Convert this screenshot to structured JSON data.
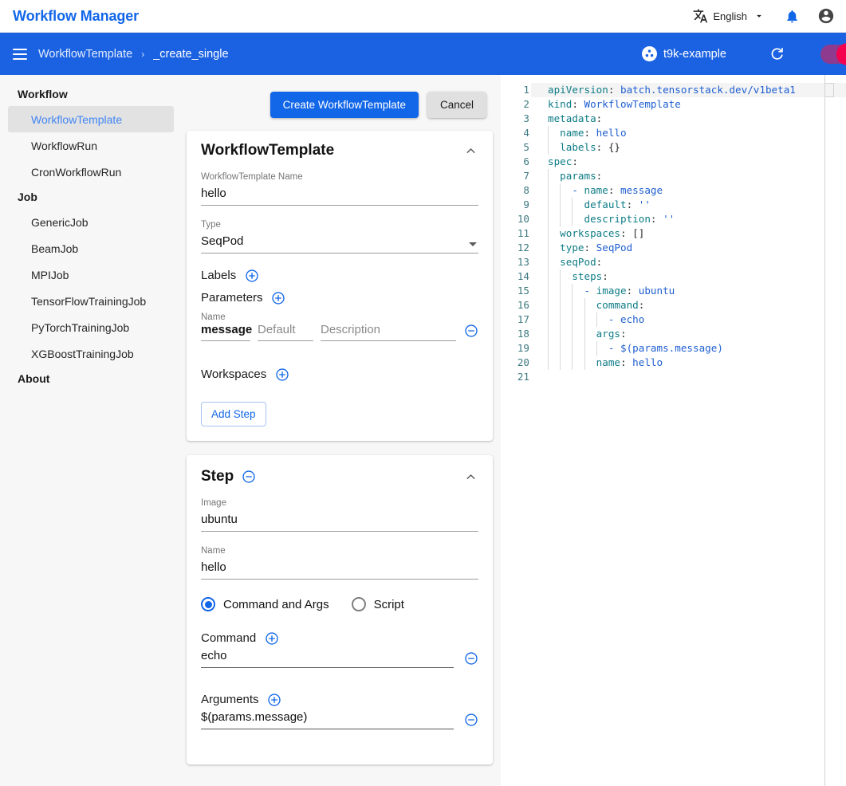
{
  "header": {
    "app_title": "Workflow Manager",
    "translate_icon": "translate-icon",
    "language": "English",
    "chevron": "chevron-down-icon",
    "bell": "notifications-icon",
    "account": "account-circle-icon"
  },
  "toolbar": {
    "menu_icon": "hamburger-menu-icon",
    "breadcrumb_root": "WorkflowTemplate",
    "breadcrumb_sep": "›",
    "breadcrumb_leaf": "_create_single",
    "project": "t9k-example",
    "project_icon": "project-avatar-icon",
    "refresh_icon": "refresh-icon",
    "toggle_name": "theme-toggle",
    "bar_color": "#1b62e3",
    "toggle_track_color": "#8e3a8e",
    "toggle_knob_color": "#f5004f"
  },
  "sidebar": {
    "groups": [
      {
        "title": "Workflow",
        "items": [
          {
            "label": "WorkflowTemplate",
            "selected": true
          },
          {
            "label": "WorkflowRun",
            "selected": false
          },
          {
            "label": "CronWorkflowRun",
            "selected": false
          }
        ]
      },
      {
        "title": "Job",
        "items": [
          {
            "label": "GenericJob",
            "selected": false
          },
          {
            "label": "BeamJob",
            "selected": false
          },
          {
            "label": "MPIJob",
            "selected": false
          },
          {
            "label": "TensorFlowTrainingJob",
            "selected": false
          },
          {
            "label": "PyTorchTrainingJob",
            "selected": false
          },
          {
            "label": "XGBoostTrainingJob",
            "selected": false
          }
        ]
      },
      {
        "title": "About",
        "items": []
      }
    ],
    "selected_color": "#4285f4"
  },
  "actions": {
    "create_label": "Create WorkflowTemplate",
    "cancel_label": "Cancel",
    "primary_color": "#1266e8"
  },
  "template_card": {
    "title": "WorkflowTemplate",
    "collapse_icon": "chevron-up-icon",
    "name_label": "WorkflowTemplate Name",
    "name_value": "hello",
    "type_label": "Type",
    "type_value": "SeqPod",
    "labels_label": "Labels",
    "labels_add_icon": "add-circle-icon",
    "parameters_label": "Parameters",
    "parameters_add_icon": "add-circle-icon",
    "param_col_name": "Name",
    "param_name_value": "message",
    "param_default_placeholder": "Default",
    "param_description_placeholder": "Description",
    "param_remove_icon": "remove-circle-icon",
    "workspaces_label": "Workspaces",
    "workspaces_add_icon": "add-circle-icon",
    "add_step_label": "Add Step"
  },
  "step_card": {
    "title": "Step",
    "remove_icon": "remove-circle-icon",
    "collapse_icon": "chevron-up-icon",
    "image_label": "Image",
    "image_value": "ubuntu",
    "name_label": "Name",
    "name_value": "hello",
    "mode_command_label": "Command and Args",
    "mode_script_label": "Script",
    "mode_selected": "Command and Args",
    "command_label": "Command",
    "command_add_icon": "add-circle-icon",
    "command_value": "echo",
    "command_remove_icon": "remove-circle-icon",
    "arguments_label": "Arguments",
    "arguments_add_icon": "add-circle-icon",
    "arguments_value": "$(params.message)",
    "arguments_remove_icon": "remove-circle-icon"
  },
  "editor": {
    "total_lines": 21,
    "active_line": 1,
    "lines": [
      {
        "n": 1,
        "guides": 0,
        "tokens": [
          {
            "t": "apiVersion",
            "c": "k"
          },
          {
            "t": ": ",
            "c": "p"
          },
          {
            "t": "batch.tensorstack.dev/v1beta1",
            "c": "v"
          }
        ]
      },
      {
        "n": 2,
        "guides": 0,
        "tokens": [
          {
            "t": "kind",
            "c": "k"
          },
          {
            "t": ": ",
            "c": "p"
          },
          {
            "t": "WorkflowTemplate",
            "c": "v"
          }
        ]
      },
      {
        "n": 3,
        "guides": 0,
        "tokens": [
          {
            "t": "metadata",
            "c": "k"
          },
          {
            "t": ":",
            "c": "p"
          }
        ]
      },
      {
        "n": 4,
        "guides": 1,
        "tokens": [
          {
            "t": "  name",
            "c": "k"
          },
          {
            "t": ": ",
            "c": "p"
          },
          {
            "t": "hello",
            "c": "v"
          }
        ]
      },
      {
        "n": 5,
        "guides": 1,
        "tokens": [
          {
            "t": "  labels",
            "c": "k"
          },
          {
            "t": ": ",
            "c": "p"
          },
          {
            "t": "{}",
            "c": "p"
          }
        ]
      },
      {
        "n": 6,
        "guides": 0,
        "tokens": [
          {
            "t": "spec",
            "c": "k"
          },
          {
            "t": ":",
            "c": "p"
          }
        ]
      },
      {
        "n": 7,
        "guides": 1,
        "tokens": [
          {
            "t": "  params",
            "c": "k"
          },
          {
            "t": ":",
            "c": "p"
          }
        ]
      },
      {
        "n": 8,
        "guides": 2,
        "tokens": [
          {
            "t": "    - ",
            "c": "d"
          },
          {
            "t": "name",
            "c": "k"
          },
          {
            "t": ": ",
            "c": "p"
          },
          {
            "t": "message",
            "c": "v"
          }
        ]
      },
      {
        "n": 9,
        "guides": 3,
        "tokens": [
          {
            "t": "      default",
            "c": "k"
          },
          {
            "t": ": ",
            "c": "p"
          },
          {
            "t": "''",
            "c": "s"
          }
        ]
      },
      {
        "n": 10,
        "guides": 3,
        "tokens": [
          {
            "t": "      description",
            "c": "k"
          },
          {
            "t": ": ",
            "c": "p"
          },
          {
            "t": "''",
            "c": "s"
          }
        ]
      },
      {
        "n": 11,
        "guides": 1,
        "tokens": [
          {
            "t": "  workspaces",
            "c": "k"
          },
          {
            "t": ": ",
            "c": "p"
          },
          {
            "t": "[]",
            "c": "p"
          }
        ]
      },
      {
        "n": 12,
        "guides": 1,
        "tokens": [
          {
            "t": "  type",
            "c": "k"
          },
          {
            "t": ": ",
            "c": "p"
          },
          {
            "t": "SeqPod",
            "c": "v"
          }
        ]
      },
      {
        "n": 13,
        "guides": 1,
        "tokens": [
          {
            "t": "  seqPod",
            "c": "k"
          },
          {
            "t": ":",
            "c": "p"
          }
        ]
      },
      {
        "n": 14,
        "guides": 2,
        "tokens": [
          {
            "t": "    steps",
            "c": "k"
          },
          {
            "t": ":",
            "c": "p"
          }
        ]
      },
      {
        "n": 15,
        "guides": 3,
        "tokens": [
          {
            "t": "      - ",
            "c": "d"
          },
          {
            "t": "image",
            "c": "k"
          },
          {
            "t": ": ",
            "c": "p"
          },
          {
            "t": "ubuntu",
            "c": "v"
          }
        ]
      },
      {
        "n": 16,
        "guides": 4,
        "tokens": [
          {
            "t": "        command",
            "c": "k"
          },
          {
            "t": ":",
            "c": "p"
          }
        ]
      },
      {
        "n": 17,
        "guides": 5,
        "tokens": [
          {
            "t": "          - ",
            "c": "d"
          },
          {
            "t": "echo",
            "c": "v"
          }
        ]
      },
      {
        "n": 18,
        "guides": 4,
        "tokens": [
          {
            "t": "        args",
            "c": "k"
          },
          {
            "t": ":",
            "c": "p"
          }
        ]
      },
      {
        "n": 19,
        "guides": 5,
        "tokens": [
          {
            "t": "          - ",
            "c": "d"
          },
          {
            "t": "$(params.message)",
            "c": "v"
          }
        ]
      },
      {
        "n": 20,
        "guides": 4,
        "tokens": [
          {
            "t": "        name",
            "c": "k"
          },
          {
            "t": ": ",
            "c": "p"
          },
          {
            "t": "hello",
            "c": "v"
          }
        ]
      },
      {
        "n": 21,
        "guides": 0,
        "tokens": []
      }
    ]
  }
}
